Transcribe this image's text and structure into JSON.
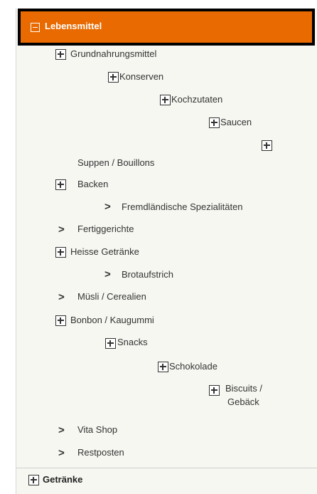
{
  "header": {
    "label": "Lebensmittel"
  },
  "items": {
    "grundnahrungsmittel": "Grundnahrungsmittel",
    "konserven": "Konserven",
    "kochzutaten": "Kochzutaten",
    "saucen": "Saucen",
    "suppen": "Suppen / Bouillons",
    "backen": "Backen",
    "fremdlaendisch": "Fremdländische Spezialitäten",
    "fertiggerichte": "Fertiggerichte",
    "heisse_getraenke": "Heisse Getränke",
    "brotaufstrich": "Brotaufstrich",
    "muesli": "Müsli / Cerealien",
    "bonbon": "Bonbon / Kaugummi",
    "snacks": "Snacks",
    "schokolade": "Schokolade",
    "biscuits_line1": "Biscuits /",
    "biscuits_line2": "Gebäck",
    "vita_shop": "Vita Shop",
    "restposten": "Restposten"
  },
  "footer": {
    "label": "Getränke"
  },
  "icons": {
    "expand": "plus-box-icon",
    "collapse": "minus-box-icon",
    "leaf": "chevron-right-icon"
  },
  "colors": {
    "header_bg": "#e86a00",
    "panel_bg": "#f6f7f1",
    "text": "#333333"
  }
}
